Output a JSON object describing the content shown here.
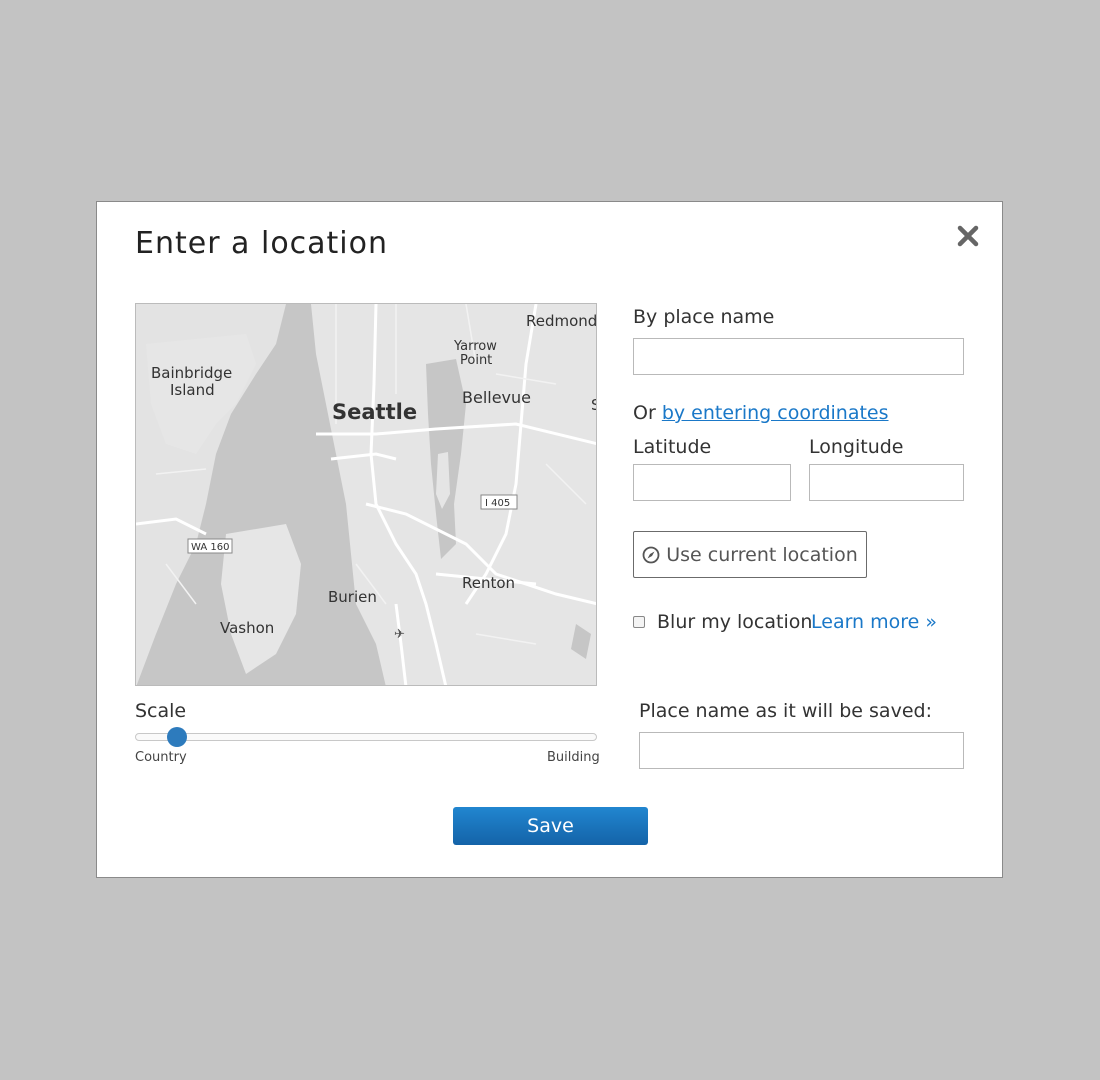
{
  "dialog": {
    "title": "Enter a location",
    "close_icon": "close-icon"
  },
  "map": {
    "labels": {
      "redmond": "Redmond",
      "yarrow": "Yarrow",
      "point": "Point",
      "bainbridge": "Bainbridge",
      "island": "Island",
      "seattle": "Seattle",
      "bellevue": "Bellevue",
      "s": "S",
      "i405": "I 405",
      "wa160": "WA 160",
      "renton": "Renton",
      "burien": "Burien",
      "vashon": "Vashon"
    }
  },
  "place": {
    "label": "By place name",
    "value": "",
    "placeholder": ""
  },
  "coords": {
    "or_text": "Or",
    "link_text": "by entering coordinates",
    "latitude_label": "Latitude",
    "longitude_label": "Longitude",
    "latitude_value": "",
    "longitude_value": ""
  },
  "current_location": {
    "label": "Use current location",
    "icon": "compass-icon"
  },
  "blur": {
    "label": "Blur my location",
    "checked": false,
    "learn_more": "Learn more »"
  },
  "scale": {
    "label": "Scale",
    "min_label": "Country",
    "max_label": "Building",
    "value": 0.09
  },
  "saved_name": {
    "label": "Place name as it will be saved:",
    "value": ""
  },
  "save": {
    "label": "Save"
  },
  "colors": {
    "accent": "#1a78c8",
    "save_button": "#1a72bd",
    "backdrop": "#c3c3c3"
  }
}
